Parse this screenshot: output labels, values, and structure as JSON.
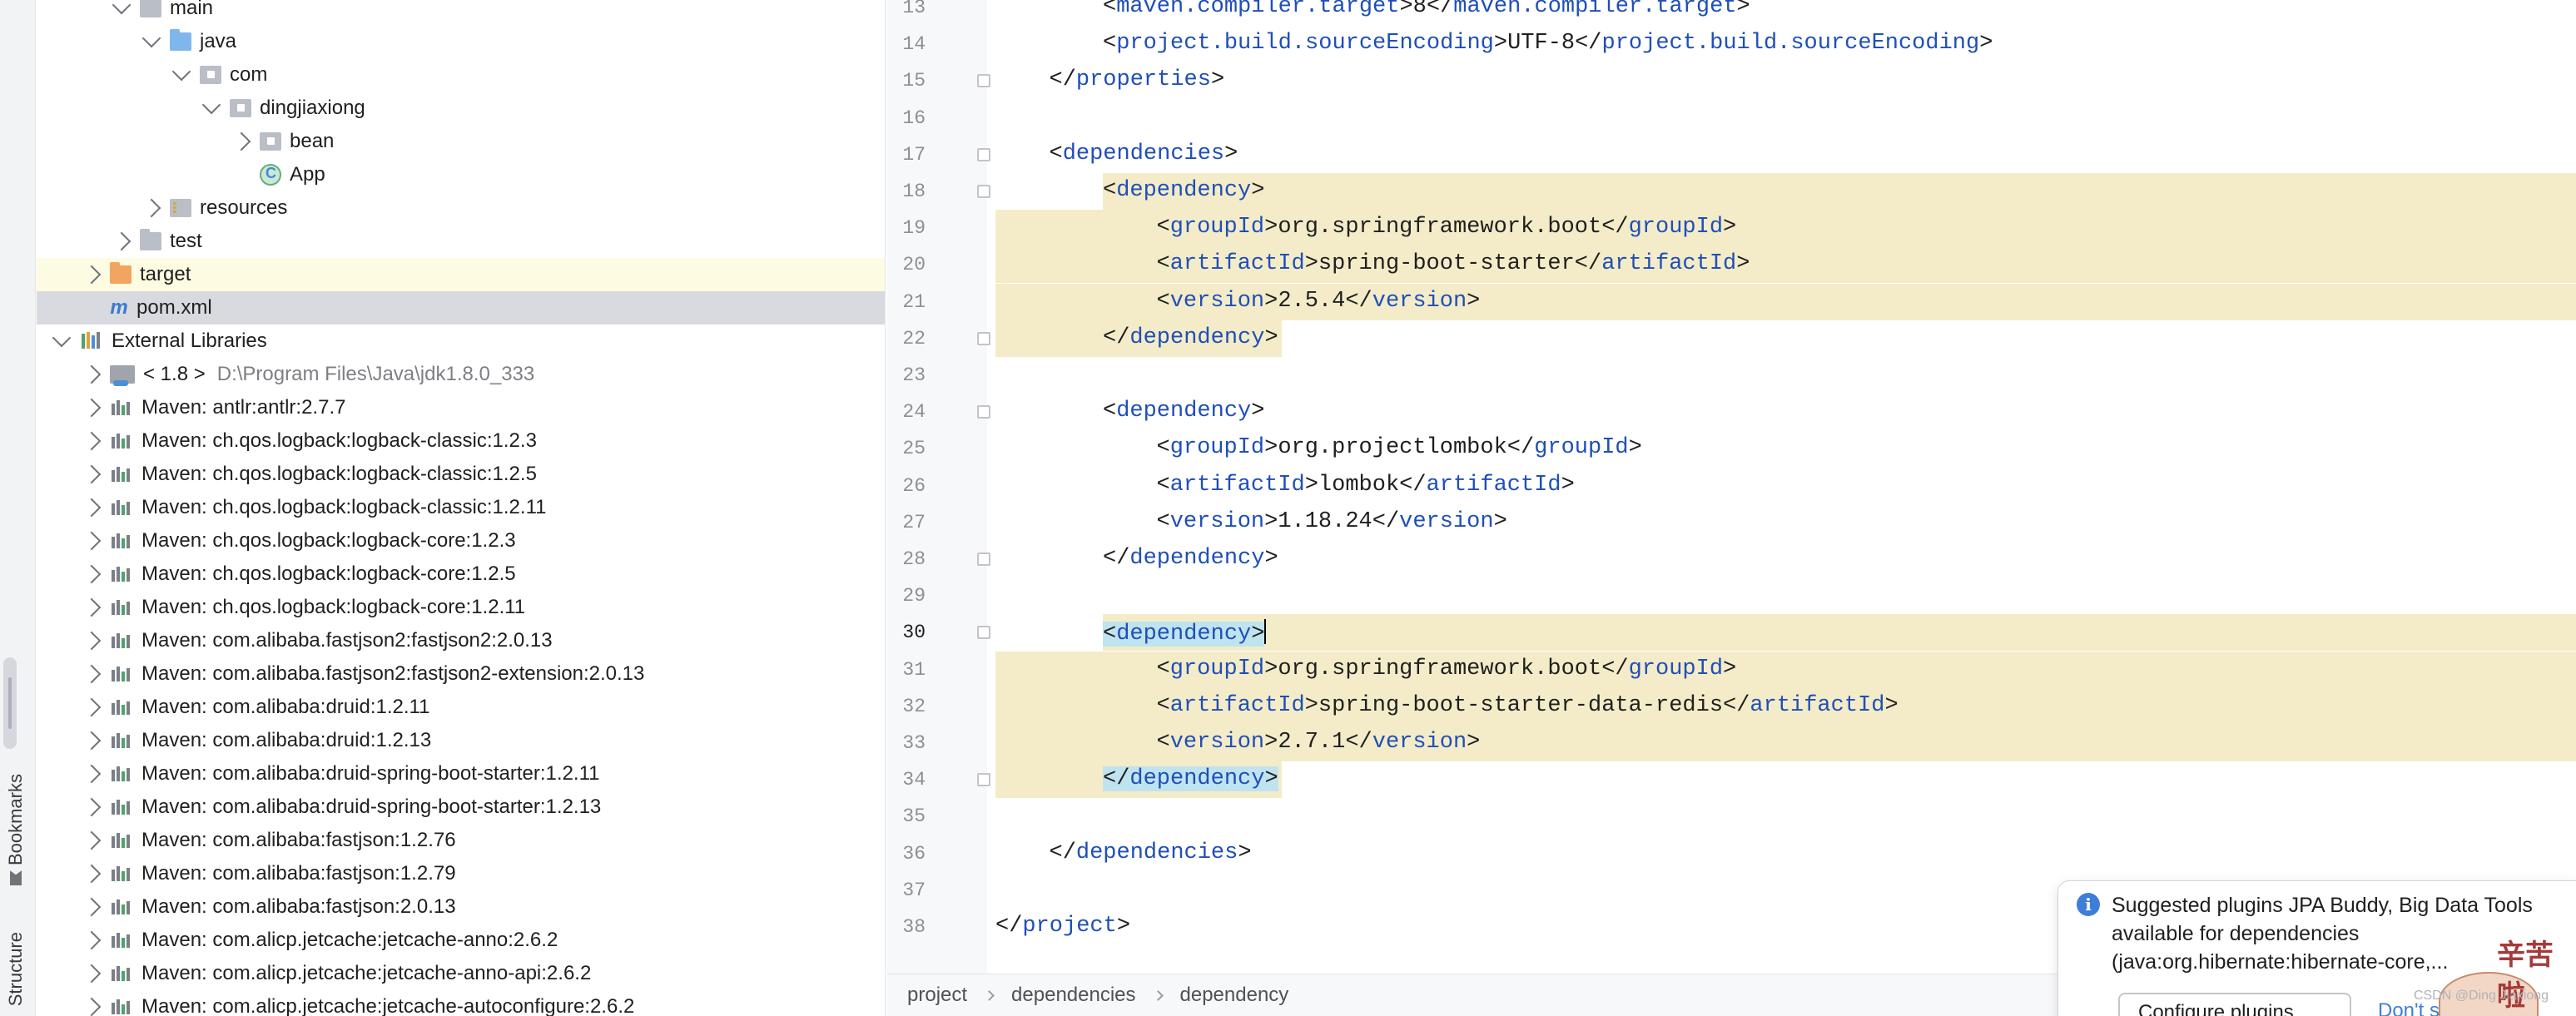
{
  "sidebar_tabs": {
    "bookmarks": "Bookmarks",
    "structure": "Structure"
  },
  "tree": [
    {
      "label": "main",
      "icon": "folder-icon",
      "indent": 2,
      "state": "open"
    },
    {
      "label": "java",
      "icon": "folder-blue-icon",
      "indent": 3,
      "state": "open"
    },
    {
      "label": "com",
      "icon": "package-icon",
      "indent": 4,
      "state": "open"
    },
    {
      "label": "dingjiaxiong",
      "icon": "package-icon",
      "indent": 5,
      "state": "open"
    },
    {
      "label": "bean",
      "icon": "package-icon",
      "indent": 6,
      "state": "closed"
    },
    {
      "label": "App",
      "icon": "class-icon",
      "indent": 6,
      "state": "none"
    },
    {
      "label": "resources",
      "icon": "resources-folder-icon",
      "indent": 3,
      "state": "closed"
    },
    {
      "label": "test",
      "icon": "folder-icon",
      "indent": 2,
      "state": "closed"
    },
    {
      "label": "target",
      "icon": "folder-orange-icon",
      "indent": 1,
      "state": "closed",
      "highlight": "yellow"
    },
    {
      "label": "pom.xml",
      "icon": "maven-icon",
      "indent": 1,
      "state": "none",
      "highlight": "gray"
    },
    {
      "label": "External Libraries",
      "icon": "libraries-icon",
      "indent": 0,
      "state": "open"
    },
    {
      "label": "< 1.8 >",
      "extra": "D:\\Program Files\\Java\\jdk1.8.0_333",
      "icon": "jdk-icon",
      "indent": 1,
      "state": "closed"
    },
    {
      "label": "Maven: antlr:antlr:2.7.7",
      "icon": "maven-library-icon",
      "indent": 1,
      "state": "closed"
    },
    {
      "label": "Maven: ch.qos.logback:logback-classic:1.2.3",
      "icon": "maven-library-icon",
      "indent": 1,
      "state": "closed"
    },
    {
      "label": "Maven: ch.qos.logback:logback-classic:1.2.5",
      "icon": "maven-library-icon",
      "indent": 1,
      "state": "closed"
    },
    {
      "label": "Maven: ch.qos.logback:logback-classic:1.2.11",
      "icon": "maven-library-icon",
      "indent": 1,
      "state": "closed"
    },
    {
      "label": "Maven: ch.qos.logback:logback-core:1.2.3",
      "icon": "maven-library-icon",
      "indent": 1,
      "state": "closed"
    },
    {
      "label": "Maven: ch.qos.logback:logback-core:1.2.5",
      "icon": "maven-library-icon",
      "indent": 1,
      "state": "closed"
    },
    {
      "label": "Maven: ch.qos.logback:logback-core:1.2.11",
      "icon": "maven-library-icon",
      "indent": 1,
      "state": "closed"
    },
    {
      "label": "Maven: com.alibaba.fastjson2:fastjson2:2.0.13",
      "icon": "maven-library-icon",
      "indent": 1,
      "state": "closed"
    },
    {
      "label": "Maven: com.alibaba.fastjson2:fastjson2-extension:2.0.13",
      "icon": "maven-library-icon",
      "indent": 1,
      "state": "closed"
    },
    {
      "label": "Maven: com.alibaba:druid:1.2.11",
      "icon": "maven-library-icon",
      "indent": 1,
      "state": "closed"
    },
    {
      "label": "Maven: com.alibaba:druid:1.2.13",
      "icon": "maven-library-icon",
      "indent": 1,
      "state": "closed"
    },
    {
      "label": "Maven: com.alibaba:druid-spring-boot-starter:1.2.11",
      "icon": "maven-library-icon",
      "indent": 1,
      "state": "closed"
    },
    {
      "label": "Maven: com.alibaba:druid-spring-boot-starter:1.2.13",
      "icon": "maven-library-icon",
      "indent": 1,
      "state": "closed"
    },
    {
      "label": "Maven: com.alibaba:fastjson:1.2.76",
      "icon": "maven-library-icon",
      "indent": 1,
      "state": "closed"
    },
    {
      "label": "Maven: com.alibaba:fastjson:1.2.79",
      "icon": "maven-library-icon",
      "indent": 1,
      "state": "closed"
    },
    {
      "label": "Maven: com.alibaba:fastjson:2.0.13",
      "icon": "maven-library-icon",
      "indent": 1,
      "state": "closed"
    },
    {
      "label": "Maven: com.alicp.jetcache:jetcache-anno:2.6.2",
      "icon": "maven-library-icon",
      "indent": 1,
      "state": "closed"
    },
    {
      "label": "Maven: com.alicp.jetcache:jetcache-anno-api:2.6.2",
      "icon": "maven-library-icon",
      "indent": 1,
      "state": "closed"
    },
    {
      "label": "Maven: com.alicp.jetcache:jetcache-autoconfigure:2.6.2",
      "icon": "maven-library-icon",
      "indent": 1,
      "state": "closed"
    }
  ],
  "editor": {
    "current_line": 30,
    "lines": [
      {
        "num": "13",
        "indent": 2,
        "tokens": [
          [
            "b",
            "<"
          ],
          [
            "t",
            "maven.compiler.target"
          ],
          [
            "b",
            ">8</"
          ],
          [
            "t",
            "maven.compiler.target"
          ],
          [
            "b",
            ">"
          ]
        ]
      },
      {
        "num": "14",
        "indent": 2,
        "tokens": [
          [
            "b",
            "<"
          ],
          [
            "t",
            "project.build.sourceEncoding"
          ],
          [
            "b",
            ">UTF-8</"
          ],
          [
            "t",
            "project.build.sourceEncoding"
          ],
          [
            "b",
            ">"
          ]
        ]
      },
      {
        "num": "15",
        "indent": 1,
        "fold": true,
        "tokens": [
          [
            "b",
            "</"
          ],
          [
            "t",
            "properties"
          ],
          [
            "b",
            ">"
          ]
        ]
      },
      {
        "num": "16",
        "indent": 0,
        "tokens": []
      },
      {
        "num": "17",
        "indent": 1,
        "fold": true,
        "tokens": [
          [
            "b",
            "<"
          ],
          [
            "t",
            "dependencies"
          ],
          [
            "b",
            ">"
          ]
        ]
      },
      {
        "num": "18",
        "indent": 2,
        "fold": true,
        "hl": "partial",
        "tokens": [
          [
            "b",
            "<"
          ],
          [
            "t",
            "dependency"
          ],
          [
            "b",
            ">"
          ]
        ]
      },
      {
        "num": "19",
        "indent": 3,
        "hl": "full",
        "tokens": [
          [
            "b",
            "<"
          ],
          [
            "t",
            "groupId"
          ],
          [
            "b",
            ">org.springframework.boot</"
          ],
          [
            "t",
            "groupId"
          ],
          [
            "b",
            ">"
          ]
        ]
      },
      {
        "num": "20",
        "indent": 3,
        "hl": "full",
        "tokens": [
          [
            "b",
            "<"
          ],
          [
            "t",
            "artifactId"
          ],
          [
            "b",
            ">spring-boot-starter</"
          ],
          [
            "t",
            "artifactId"
          ],
          [
            "b",
            ">"
          ]
        ]
      },
      {
        "num": "21",
        "indent": 3,
        "hl": "full",
        "tokens": [
          [
            "b",
            "<"
          ],
          [
            "t",
            "version"
          ],
          [
            "b",
            ">2.5.4</"
          ],
          [
            "t",
            "version"
          ],
          [
            "b",
            ">"
          ]
        ]
      },
      {
        "num": "22",
        "indent": 2,
        "fold": true,
        "hl": "block",
        "tokens": [
          [
            "b",
            "</"
          ],
          [
            "t",
            "dependency"
          ],
          [
            "b",
            ">"
          ]
        ]
      },
      {
        "num": "23",
        "indent": 0,
        "tokens": []
      },
      {
        "num": "24",
        "indent": 2,
        "fold": true,
        "tokens": [
          [
            "b",
            "<"
          ],
          [
            "t",
            "dependency"
          ],
          [
            "b",
            ">"
          ]
        ]
      },
      {
        "num": "25",
        "indent": 3,
        "tokens": [
          [
            "b",
            "<"
          ],
          [
            "t",
            "groupId"
          ],
          [
            "b",
            ">org.projectlombok</"
          ],
          [
            "t",
            "groupId"
          ],
          [
            "b",
            ">"
          ]
        ]
      },
      {
        "num": "26",
        "indent": 3,
        "tokens": [
          [
            "b",
            "<"
          ],
          [
            "t",
            "artifactId"
          ],
          [
            "b",
            ">lombok</"
          ],
          [
            "t",
            "artifactId"
          ],
          [
            "b",
            ">"
          ]
        ]
      },
      {
        "num": "27",
        "indent": 3,
        "tokens": [
          [
            "b",
            "<"
          ],
          [
            "t",
            "version"
          ],
          [
            "b",
            ">1.18.24</"
          ],
          [
            "t",
            "version"
          ],
          [
            "b",
            ">"
          ]
        ]
      },
      {
        "num": "28",
        "indent": 2,
        "fold": true,
        "tokens": [
          [
            "b",
            "</"
          ],
          [
            "t",
            "dependency"
          ],
          [
            "b",
            ">"
          ]
        ]
      },
      {
        "num": "29",
        "indent": 0,
        "tokens": []
      },
      {
        "num": "30",
        "indent": 2,
        "fold": true,
        "hl": "partial",
        "box": true,
        "caret": true,
        "tokens": [
          [
            "b",
            "<"
          ],
          [
            "t",
            "dependency"
          ],
          [
            "b",
            ">"
          ]
        ]
      },
      {
        "num": "31",
        "indent": 3,
        "hl": "full",
        "tokens": [
          [
            "b",
            "<"
          ],
          [
            "t",
            "groupId"
          ],
          [
            "b",
            ">org.springframework.boot</"
          ],
          [
            "t",
            "groupId"
          ],
          [
            "b",
            ">"
          ]
        ]
      },
      {
        "num": "32",
        "indent": 3,
        "hl": "full",
        "tokens": [
          [
            "b",
            "<"
          ],
          [
            "t",
            "artifactId"
          ],
          [
            "b",
            ">spring-boot-starter-data-redis</"
          ],
          [
            "t",
            "artifactId"
          ],
          [
            "b",
            ">"
          ]
        ]
      },
      {
        "num": "33",
        "indent": 3,
        "hl": "full",
        "tokens": [
          [
            "b",
            "<"
          ],
          [
            "t",
            "version"
          ],
          [
            "b",
            ">2.7.1</"
          ],
          [
            "t",
            "version"
          ],
          [
            "b",
            ">"
          ]
        ]
      },
      {
        "num": "34",
        "indent": 2,
        "fold": true,
        "hl": "block",
        "box": true,
        "tokens": [
          [
            "b",
            "</"
          ],
          [
            "t",
            "dependency"
          ],
          [
            "b",
            ">"
          ]
        ]
      },
      {
        "num": "35",
        "indent": 0,
        "tokens": []
      },
      {
        "num": "36",
        "indent": 1,
        "tokens": [
          [
            "b",
            "</"
          ],
          [
            "t",
            "dependencies"
          ],
          [
            "b",
            ">"
          ]
        ]
      },
      {
        "num": "37",
        "indent": 0,
        "tokens": []
      },
      {
        "num": "38",
        "indent": 0,
        "tokens": [
          [
            "b",
            "</"
          ],
          [
            "t",
            "project"
          ],
          [
            "b",
            ">"
          ]
        ]
      }
    ]
  },
  "breadcrumb": [
    "project",
    "dependencies",
    "dependency"
  ],
  "notification": {
    "text": "Suggested plugins JPA Buddy, Big Data Tools available for dependencies (java:org.hibernate:hibernate-core,...",
    "primary_button": "Configure plugins...",
    "secondary_link": "Don't suggest"
  },
  "watermark": "CSDN @Ding Jiaxiong",
  "sticker_text": "辛苦啦",
  "colors": {
    "tag": "#1f4fb8",
    "highlight": "#f4ecc8",
    "selected_row": "#d9dadf",
    "target_row": "#fdfbe2",
    "accent": "#3f7ed8"
  }
}
